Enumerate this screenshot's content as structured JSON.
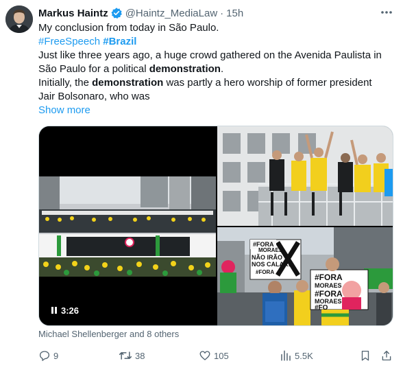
{
  "author": {
    "name": "Markus Haintz",
    "handle": "@Haintz_MediaLaw",
    "separator": "·",
    "time": "15h"
  },
  "icons": {
    "verified": "verified-badge-icon",
    "more": "more-horizontal-icon",
    "reply": "reply-icon",
    "retweet": "retweet-icon",
    "like": "heart-icon",
    "views": "views-icon",
    "bookmark": "bookmark-icon",
    "share": "share-icon"
  },
  "colors": {
    "link": "#1d9bf0",
    "verified": "#1d9bf0",
    "muted": "#536471",
    "text": "#0f1419"
  },
  "text": {
    "line1": "My conclusion from today in São Paulo.",
    "hashtag1": "#FreeSpeech",
    "hashtag2": "#Brazil",
    "line3": "Just like three years ago, a huge crowd gathered on the Avenida Paulista in",
    "line4_a": "São Paulo for a political ",
    "line4_b": "demonstration",
    "line4_c": ".",
    "line5_a": "Initially, the ",
    "line5_b": "demonstration",
    "line5_c": " was partly a hero worship of former president",
    "line6": "Jair Bolsonaro, who was",
    "show_more": "Show more"
  },
  "media": {
    "video_duration": "3:26",
    "sign_top_1": "#FORA",
    "sign_top_2": "MORAES",
    "sign_top_3": "NÃO IRÃO",
    "sign_top_4": "NOS CALAR!",
    "sign_top_5": "#FORA",
    "sign_bottom_1": "#FORA",
    "sign_bottom_2": "MORAES",
    "sign_bottom_3": "#FORA",
    "sign_bottom_4": "MORAES",
    "sign_bottom_5": "#FO"
  },
  "tagged": "Michael Shellenberger and 8 others",
  "stats": {
    "replies": "9",
    "retweets": "38",
    "likes": "105",
    "views": "5.5K"
  }
}
